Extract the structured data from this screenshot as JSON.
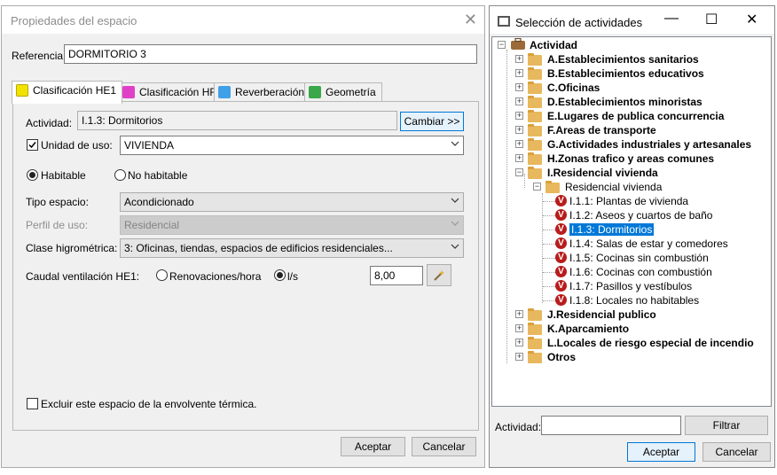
{
  "left_window": {
    "title": "Propiedades del espacio",
    "referencia_label": "Referencia:",
    "referencia_value": "DORMITORIO 3",
    "tabs": [
      {
        "label": "Clasificación HE1",
        "icon": "yellow-rect-icon",
        "color": "#f2e200"
      },
      {
        "label": "Clasificación HR",
        "icon": "music-note-icon",
        "color": "#e040c8"
      },
      {
        "label": "Reverberación",
        "icon": "music-note-blue-icon",
        "color": "#3fa0e8"
      },
      {
        "label": "Geometría",
        "icon": "chart-icon",
        "color": "#3aa848"
      }
    ],
    "actividad_label": "Actividad:",
    "actividad_value": "I.1.3: Dormitorios",
    "cambiar_label": "Cambiar >>",
    "unidad_uso_label": "Unidad de uso:",
    "unidad_uso_checked": true,
    "unidad_uso_value": "VIVIENDA",
    "habitable_label": "Habitable",
    "no_habitable_label": "No habitable",
    "habitable_selected": "Habitable",
    "tipo_espacio_label": "Tipo espacio:",
    "tipo_espacio_value": "Acondicionado",
    "perfil_uso_label": "Perfil de uso:",
    "perfil_uso_value": "Residencial",
    "clase_higro_label": "Clase higrométrica:",
    "clase_higro_value": "3: Oficinas, tiendas, espacios de edificios residenciales...",
    "caudal_label": "Caudal ventilación HE1:",
    "renovaciones_label": "Renovaciones/hora",
    "ls_label": "l/s",
    "caudal_selected": "l/s",
    "caudal_value": "8,00",
    "excluir_label": "Excluir este espacio de la envolvente térmica.",
    "excluir_checked": false,
    "aceptar_label": "Aceptar",
    "cancelar_label": "Cancelar"
  },
  "right_window": {
    "title": "Selección de actividades",
    "tree": {
      "root": "Actividad",
      "items": [
        {
          "label": "A.Establecimientos sanitarios",
          "expanded": false
        },
        {
          "label": "B.Establecimientos educativos",
          "expanded": false
        },
        {
          "label": "C.Oficinas",
          "expanded": false
        },
        {
          "label": "D.Establecimientos minoristas",
          "expanded": false
        },
        {
          "label": "E.Lugares de publica concurrencia",
          "expanded": false
        },
        {
          "label": "F.Areas de transporte",
          "expanded": false
        },
        {
          "label": "G.Actividades industriales y artesanales",
          "expanded": false
        },
        {
          "label": "H.Zonas trafico y areas comunes",
          "expanded": false
        },
        {
          "label": "I.Residencial vivienda",
          "expanded": true
        },
        {
          "label": "J.Residencial publico",
          "expanded": false
        },
        {
          "label": "K.Aparcamiento",
          "expanded": false
        },
        {
          "label": "L.Locales de riesgo especial de incendio",
          "expanded": false
        },
        {
          "label": "Otros",
          "expanded": false
        }
      ],
      "sub_group": "Residencial vivienda",
      "leaves": [
        "I.1.1: Plantas de vivienda",
        "I.1.2: Aseos y cuartos de baño",
        "I.1.3: Dormitorios",
        "I.1.4: Salas de estar y comedores",
        "I.1.5: Cocinas sin combustión",
        "I.1.6: Cocinas con combustión",
        "I.1.7: Pasillos y vestíbulos",
        "I.1.8: Locales no habitables"
      ],
      "selected_leaf": "I.1.3: Dormitorios",
      "leaf_icon_letter": "V"
    },
    "actividad_label": "Actividad:",
    "actividad_value": "",
    "filtrar_label": "Filtrar",
    "aceptar_label": "Aceptar",
    "cancelar_label": "Cancelar"
  }
}
